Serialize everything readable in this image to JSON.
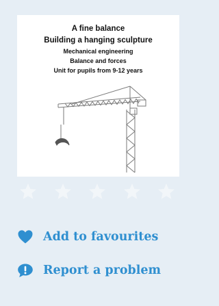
{
  "cover": {
    "title": "A fine balance",
    "subtitle": "Building a hanging sculpture",
    "topic": "Mechanical engineering",
    "subtopic": "Balance and forces",
    "audience": "Unit for pupils from 9-12 years"
  },
  "rating": {
    "max": 5,
    "value": 0
  },
  "actions": {
    "favourites_label": "Add to favourites",
    "report_label": "Report a problem"
  },
  "icons": {
    "favourites": "heart-icon",
    "report": "speech-bubble-exclamation-icon",
    "rating": "star-icon"
  },
  "colors": {
    "page_background": "#e6eef5",
    "link": "#2f8fd0",
    "star_empty": "#f2f6f9"
  }
}
